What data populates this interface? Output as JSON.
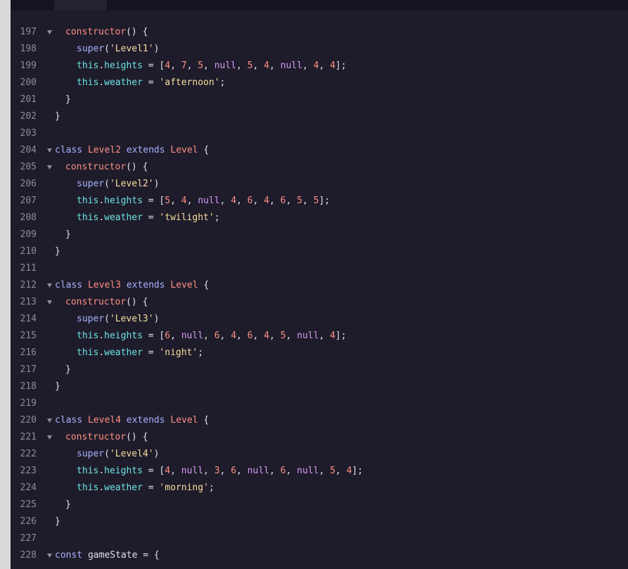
{
  "editor": {
    "lines": [
      {
        "no": "197",
        "fold": true,
        "indent": 1,
        "tokens": [
          {
            "t": "constructor",
            "c": "fn"
          },
          {
            "t": "() {",
            "c": "plain"
          }
        ]
      },
      {
        "no": "198",
        "fold": false,
        "indent": 2,
        "tokens": [
          {
            "t": "super",
            "c": "kw"
          },
          {
            "t": "(",
            "c": "plain"
          },
          {
            "t": "'Level1'",
            "c": "str"
          },
          {
            "t": ")",
            "c": "plain"
          }
        ]
      },
      {
        "no": "199",
        "fold": false,
        "indent": 2,
        "tokens": [
          {
            "t": "this",
            "c": "this"
          },
          {
            "t": ".",
            "c": "plain"
          },
          {
            "t": "heights",
            "c": "prop"
          },
          {
            "t": " = [",
            "c": "plain"
          },
          {
            "t": "4",
            "c": "num"
          },
          {
            "t": ", ",
            "c": "plain"
          },
          {
            "t": "7",
            "c": "num"
          },
          {
            "t": ", ",
            "c": "plain"
          },
          {
            "t": "5",
            "c": "num"
          },
          {
            "t": ", ",
            "c": "plain"
          },
          {
            "t": "null",
            "c": "null"
          },
          {
            "t": ", ",
            "c": "plain"
          },
          {
            "t": "5",
            "c": "num"
          },
          {
            "t": ", ",
            "c": "plain"
          },
          {
            "t": "4",
            "c": "num"
          },
          {
            "t": ", ",
            "c": "plain"
          },
          {
            "t": "null",
            "c": "null"
          },
          {
            "t": ", ",
            "c": "plain"
          },
          {
            "t": "4",
            "c": "num"
          },
          {
            "t": ", ",
            "c": "plain"
          },
          {
            "t": "4",
            "c": "num"
          },
          {
            "t": "];",
            "c": "plain"
          }
        ]
      },
      {
        "no": "200",
        "fold": false,
        "indent": 2,
        "tokens": [
          {
            "t": "this",
            "c": "this"
          },
          {
            "t": ".",
            "c": "plain"
          },
          {
            "t": "weather",
            "c": "prop"
          },
          {
            "t": " = ",
            "c": "plain"
          },
          {
            "t": "'afternoon'",
            "c": "str"
          },
          {
            "t": ";",
            "c": "plain"
          }
        ]
      },
      {
        "no": "201",
        "fold": false,
        "indent": 1,
        "tokens": [
          {
            "t": "}",
            "c": "plain"
          }
        ]
      },
      {
        "no": "202",
        "fold": false,
        "indent": 0,
        "tokens": [
          {
            "t": "}",
            "c": "plain"
          }
        ]
      },
      {
        "no": "203",
        "fold": false,
        "indent": 0,
        "tokens": []
      },
      {
        "no": "204",
        "fold": true,
        "indent": 0,
        "tokens": [
          {
            "t": "class ",
            "c": "kw"
          },
          {
            "t": "Level2",
            "c": "fn"
          },
          {
            "t": " extends ",
            "c": "kw"
          },
          {
            "t": "Level",
            "c": "fn"
          },
          {
            "t": " {",
            "c": "plain"
          }
        ]
      },
      {
        "no": "205",
        "fold": true,
        "indent": 1,
        "tokens": [
          {
            "t": "constructor",
            "c": "fn"
          },
          {
            "t": "() {",
            "c": "plain"
          }
        ]
      },
      {
        "no": "206",
        "fold": false,
        "indent": 2,
        "tokens": [
          {
            "t": "super",
            "c": "kw"
          },
          {
            "t": "(",
            "c": "plain"
          },
          {
            "t": "'Level2'",
            "c": "str"
          },
          {
            "t": ")",
            "c": "plain"
          }
        ]
      },
      {
        "no": "207",
        "fold": false,
        "indent": 2,
        "tokens": [
          {
            "t": "this",
            "c": "this"
          },
          {
            "t": ".",
            "c": "plain"
          },
          {
            "t": "heights",
            "c": "prop"
          },
          {
            "t": " = [",
            "c": "plain"
          },
          {
            "t": "5",
            "c": "num"
          },
          {
            "t": ", ",
            "c": "plain"
          },
          {
            "t": "4",
            "c": "num"
          },
          {
            "t": ", ",
            "c": "plain"
          },
          {
            "t": "null",
            "c": "null"
          },
          {
            "t": ", ",
            "c": "plain"
          },
          {
            "t": "4",
            "c": "num"
          },
          {
            "t": ", ",
            "c": "plain"
          },
          {
            "t": "6",
            "c": "num"
          },
          {
            "t": ", ",
            "c": "plain"
          },
          {
            "t": "4",
            "c": "num"
          },
          {
            "t": ", ",
            "c": "plain"
          },
          {
            "t": "6",
            "c": "num"
          },
          {
            "t": ", ",
            "c": "plain"
          },
          {
            "t": "5",
            "c": "num"
          },
          {
            "t": ", ",
            "c": "plain"
          },
          {
            "t": "5",
            "c": "num"
          },
          {
            "t": "];",
            "c": "plain"
          }
        ]
      },
      {
        "no": "208",
        "fold": false,
        "indent": 2,
        "tokens": [
          {
            "t": "this",
            "c": "this"
          },
          {
            "t": ".",
            "c": "plain"
          },
          {
            "t": "weather",
            "c": "prop"
          },
          {
            "t": " = ",
            "c": "plain"
          },
          {
            "t": "'twilight'",
            "c": "str"
          },
          {
            "t": ";",
            "c": "plain"
          }
        ]
      },
      {
        "no": "209",
        "fold": false,
        "indent": 1,
        "tokens": [
          {
            "t": "}",
            "c": "plain"
          }
        ]
      },
      {
        "no": "210",
        "fold": false,
        "indent": 0,
        "tokens": [
          {
            "t": "}",
            "c": "plain"
          }
        ]
      },
      {
        "no": "211",
        "fold": false,
        "indent": 0,
        "tokens": []
      },
      {
        "no": "212",
        "fold": true,
        "indent": 0,
        "tokens": [
          {
            "t": "class ",
            "c": "kw"
          },
          {
            "t": "Level3",
            "c": "fn"
          },
          {
            "t": " extends ",
            "c": "kw"
          },
          {
            "t": "Level",
            "c": "fn"
          },
          {
            "t": " {",
            "c": "plain"
          }
        ]
      },
      {
        "no": "213",
        "fold": true,
        "indent": 1,
        "tokens": [
          {
            "t": "constructor",
            "c": "fn"
          },
          {
            "t": "() {",
            "c": "plain"
          }
        ]
      },
      {
        "no": "214",
        "fold": false,
        "indent": 2,
        "tokens": [
          {
            "t": "super",
            "c": "kw"
          },
          {
            "t": "(",
            "c": "plain"
          },
          {
            "t": "'Level3'",
            "c": "str"
          },
          {
            "t": ")",
            "c": "plain"
          }
        ]
      },
      {
        "no": "215",
        "fold": false,
        "indent": 2,
        "tokens": [
          {
            "t": "this",
            "c": "this"
          },
          {
            "t": ".",
            "c": "plain"
          },
          {
            "t": "heights",
            "c": "prop"
          },
          {
            "t": " = [",
            "c": "plain"
          },
          {
            "t": "6",
            "c": "num"
          },
          {
            "t": ", ",
            "c": "plain"
          },
          {
            "t": "null",
            "c": "null"
          },
          {
            "t": ", ",
            "c": "plain"
          },
          {
            "t": "6",
            "c": "num"
          },
          {
            "t": ", ",
            "c": "plain"
          },
          {
            "t": "4",
            "c": "num"
          },
          {
            "t": ", ",
            "c": "plain"
          },
          {
            "t": "6",
            "c": "num"
          },
          {
            "t": ", ",
            "c": "plain"
          },
          {
            "t": "4",
            "c": "num"
          },
          {
            "t": ", ",
            "c": "plain"
          },
          {
            "t": "5",
            "c": "num"
          },
          {
            "t": ", ",
            "c": "plain"
          },
          {
            "t": "null",
            "c": "null"
          },
          {
            "t": ", ",
            "c": "plain"
          },
          {
            "t": "4",
            "c": "num"
          },
          {
            "t": "];",
            "c": "plain"
          }
        ]
      },
      {
        "no": "216",
        "fold": false,
        "indent": 2,
        "tokens": [
          {
            "t": "this",
            "c": "this"
          },
          {
            "t": ".",
            "c": "plain"
          },
          {
            "t": "weather",
            "c": "prop"
          },
          {
            "t": " = ",
            "c": "plain"
          },
          {
            "t": "'night'",
            "c": "str"
          },
          {
            "t": ";",
            "c": "plain"
          }
        ]
      },
      {
        "no": "217",
        "fold": false,
        "indent": 1,
        "tokens": [
          {
            "t": "}",
            "c": "plain"
          }
        ]
      },
      {
        "no": "218",
        "fold": false,
        "indent": 0,
        "tokens": [
          {
            "t": "}",
            "c": "plain"
          }
        ]
      },
      {
        "no": "219",
        "fold": false,
        "indent": 0,
        "tokens": []
      },
      {
        "no": "220",
        "fold": true,
        "indent": 0,
        "tokens": [
          {
            "t": "class ",
            "c": "kw"
          },
          {
            "t": "Level4",
            "c": "fn"
          },
          {
            "t": " extends ",
            "c": "kw"
          },
          {
            "t": "Level",
            "c": "fn"
          },
          {
            "t": " {",
            "c": "plain"
          }
        ]
      },
      {
        "no": "221",
        "fold": true,
        "indent": 1,
        "tokens": [
          {
            "t": "constructor",
            "c": "fn"
          },
          {
            "t": "() {",
            "c": "plain"
          }
        ]
      },
      {
        "no": "222",
        "fold": false,
        "indent": 2,
        "tokens": [
          {
            "t": "super",
            "c": "kw"
          },
          {
            "t": "(",
            "c": "plain"
          },
          {
            "t": "'Level4'",
            "c": "str"
          },
          {
            "t": ")",
            "c": "plain"
          }
        ]
      },
      {
        "no": "223",
        "fold": false,
        "indent": 2,
        "tokens": [
          {
            "t": "this",
            "c": "this"
          },
          {
            "t": ".",
            "c": "plain"
          },
          {
            "t": "heights",
            "c": "prop"
          },
          {
            "t": " = [",
            "c": "plain"
          },
          {
            "t": "4",
            "c": "num"
          },
          {
            "t": ", ",
            "c": "plain"
          },
          {
            "t": "null",
            "c": "null"
          },
          {
            "t": ", ",
            "c": "plain"
          },
          {
            "t": "3",
            "c": "num"
          },
          {
            "t": ", ",
            "c": "plain"
          },
          {
            "t": "6",
            "c": "num"
          },
          {
            "t": ", ",
            "c": "plain"
          },
          {
            "t": "null",
            "c": "null"
          },
          {
            "t": ", ",
            "c": "plain"
          },
          {
            "t": "6",
            "c": "num"
          },
          {
            "t": ", ",
            "c": "plain"
          },
          {
            "t": "null",
            "c": "null"
          },
          {
            "t": ", ",
            "c": "plain"
          },
          {
            "t": "5",
            "c": "num"
          },
          {
            "t": ", ",
            "c": "plain"
          },
          {
            "t": "4",
            "c": "num"
          },
          {
            "t": "];",
            "c": "plain"
          }
        ]
      },
      {
        "no": "224",
        "fold": false,
        "indent": 2,
        "tokens": [
          {
            "t": "this",
            "c": "this"
          },
          {
            "t": ".",
            "c": "plain"
          },
          {
            "t": "weather",
            "c": "prop"
          },
          {
            "t": " = ",
            "c": "plain"
          },
          {
            "t": "'morning'",
            "c": "str"
          },
          {
            "t": ";",
            "c": "plain"
          }
        ]
      },
      {
        "no": "225",
        "fold": false,
        "indent": 1,
        "tokens": [
          {
            "t": "}",
            "c": "plain"
          }
        ]
      },
      {
        "no": "226",
        "fold": false,
        "indent": 0,
        "tokens": [
          {
            "t": "}",
            "c": "plain"
          }
        ]
      },
      {
        "no": "227",
        "fold": false,
        "indent": 0,
        "tokens": []
      },
      {
        "no": "228",
        "fold": true,
        "indent": 0,
        "tokens": [
          {
            "t": "const ",
            "c": "kw"
          },
          {
            "t": "gameState",
            "c": "plain"
          },
          {
            "t": " = {",
            "c": "plain"
          }
        ]
      }
    ]
  },
  "colors": {
    "background": "#1e1c2a",
    "line_number": "#8e8c9c",
    "keyword": "#a9b1ff",
    "function": "#ff8f85",
    "property": "#6ee3e4",
    "number": "#ff8f85",
    "null": "#d79bf2",
    "string": "#f9dda0"
  },
  "icons": {
    "fold": "chevron-down-icon"
  }
}
